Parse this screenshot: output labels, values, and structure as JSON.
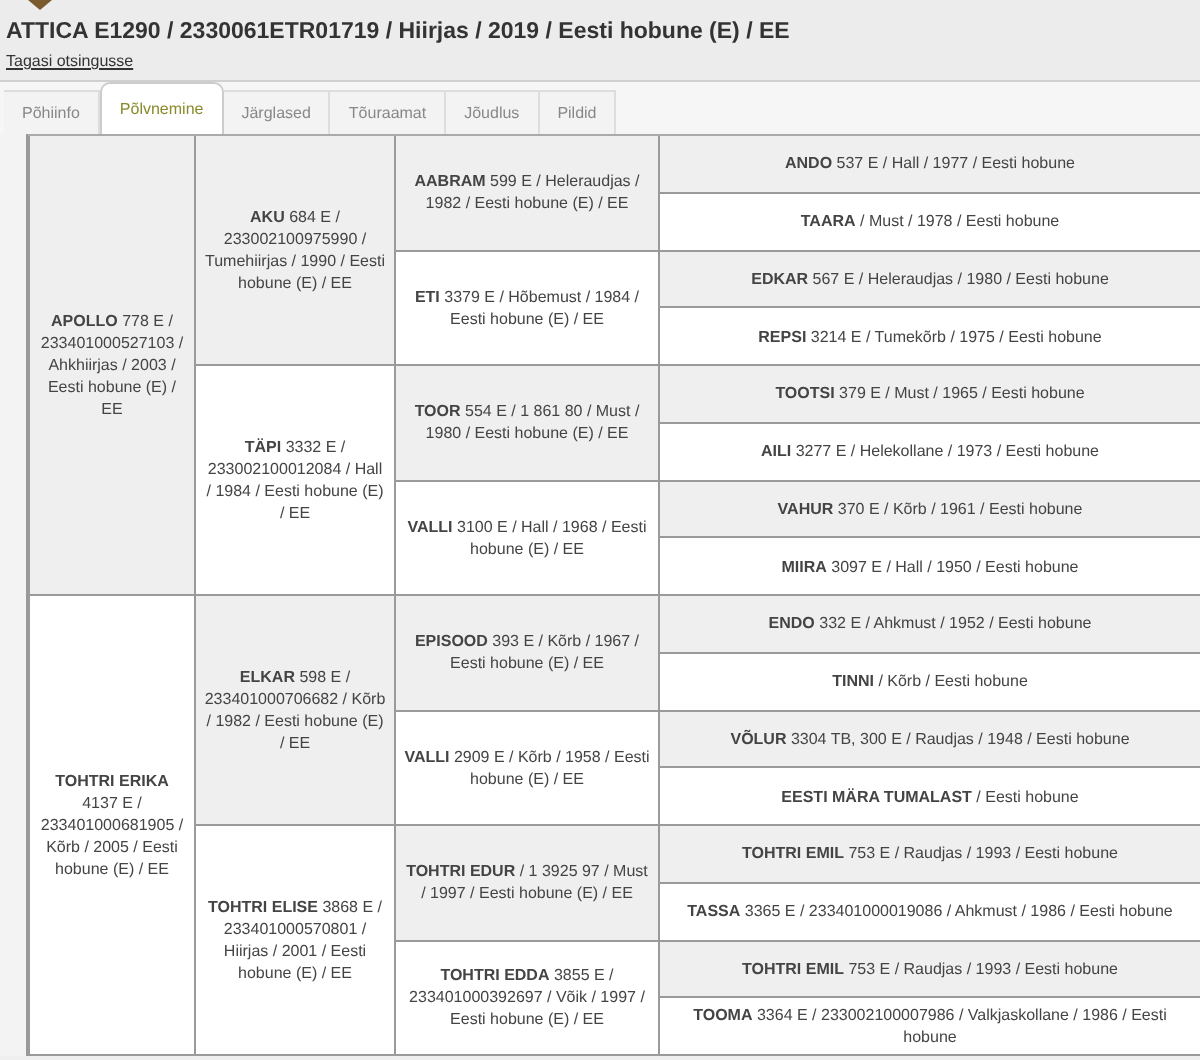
{
  "title": "ATTICA E1290 / 2330061ETR01719 / Hiirjas / 2019 / Eesti hobune (E) / EE",
  "back_link": "Tagasi otsingusse",
  "tabs": [
    {
      "label": "Põhiinfo",
      "selected": false
    },
    {
      "label": "Põlvnemine",
      "selected": true
    },
    {
      "label": "Järglased",
      "selected": false
    },
    {
      "label": "Tõuraamat",
      "selected": false
    },
    {
      "label": "Jõudlus",
      "selected": false
    },
    {
      "label": "Pildid",
      "selected": false
    }
  ],
  "pedigree": [
    {
      "text": "**APOLLO** 778 E / 233401000527103 / Ahkhiirjas / 2003 / Eesti hobune (E) / EE",
      "children": [
        {
          "text": "**AKU** 684 E / 233002100975990 / Tumehiirjas / 1990 / Eesti hobune (E) / EE",
          "children": [
            {
              "text": "**AABRAM** 599 E / Heleraudjas / 1982 / Eesti hobune (E) / EE",
              "children": [
                {
                  "text": "**ANDO** 537 E / Hall / 1977 / Eesti hobune"
                },
                {
                  "text": "**TAARA** / Must / 1978 / Eesti hobune"
                }
              ]
            },
            {
              "text": "**ETI** 3379 E / Hõbemust / 1984 / Eesti hobune (E) / EE",
              "children": [
                {
                  "text": "**EDKAR** 567 E / Heleraudjas / 1980 / Eesti hobune"
                },
                {
                  "text": "**REPSI** 3214 E / Tumekõrb / 1975 / Eesti hobune"
                }
              ]
            }
          ]
        },
        {
          "text": "**TÄPI** 3332 E / 233002100012084 / Hall / 1984 / Eesti hobune (E) / EE",
          "children": [
            {
              "text": "**TOOR** 554 E / 1 861 80 / Must / 1980 / Eesti hobune (E) / EE",
              "children": [
                {
                  "text": "**TOOTSI** 379 E / Must / 1965 / Eesti hobune"
                },
                {
                  "text": "**AILI** 3277 E / Helekollane / 1973 / Eesti hobune"
                }
              ]
            },
            {
              "text": "**VALLI** 3100 E / Hall / 1968 / Eesti hobune (E) / EE",
              "children": [
                {
                  "text": "**VAHUR** 370 E / Kõrb / 1961 / Eesti hobune"
                },
                {
                  "text": "**MIIRA** 3097 E / Hall / 1950 / Eesti hobune"
                }
              ]
            }
          ]
        }
      ]
    },
    {
      "text": "**TOHTRI ERIKA** 4137 E / 233401000681905 / Kõrb / 2005 / Eesti hobune (E) / EE",
      "children": [
        {
          "text": "**ELKAR** 598 E / 233401000706682 / Kõrb / 1982 / Eesti hobune (E) / EE",
          "children": [
            {
              "text": "**EPISOOD** 393 E / Kõrb / 1967 / Eesti hobune (E) / EE",
              "children": [
                {
                  "text": "**ENDO** 332 E / Ahkmust / 1952 / Eesti hobune"
                },
                {
                  "text": "**TINNI** / Kõrb / Eesti hobune"
                }
              ]
            },
            {
              "text": "**VALLI** 2909 E / Kõrb / 1958 / Eesti hobune (E) / EE",
              "children": [
                {
                  "text": "**VÕLUR** 3304 TB, 300 E / Raudjas / 1948 / Eesti hobune"
                },
                {
                  "text": "**EESTI MÄRA TUMALAST** / Eesti hobune"
                }
              ]
            }
          ]
        },
        {
          "text": "**TOHTRI ELISE** 3868 E / 233401000570801 / Hiirjas / 2001 / Eesti hobune (E) / EE",
          "children": [
            {
              "text": "**TOHTRI EDUR** / 1 3925 97 / Must / 1997 / Eesti hobune (E) / EE",
              "children": [
                {
                  "text": "**TOHTRI EMIL** 753 E / Raudjas / 1993 / Eesti hobune"
                },
                {
                  "text": "**TASSA** 3365 E / 233401000019086 / Ahkmust / 1986 / Eesti hobune"
                }
              ]
            },
            {
              "text": "**TOHTRI EDDA** 3855 E / 233401000392697 / Võik / 1997 / Eesti hobune (E) / EE",
              "children": [
                {
                  "text": "**TOHTRI EMIL** 753 E / Raudjas / 1993 / Eesti hobune"
                },
                {
                  "text": "**TOOMA** 3364 E / 233002100007986 / Valkjaskollane / 1986 / Eesti hobune"
                }
              ]
            }
          ]
        }
      ]
    }
  ]
}
